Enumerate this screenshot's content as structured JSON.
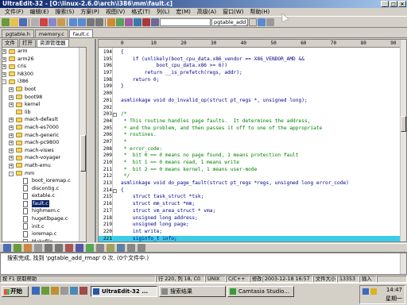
{
  "window": {
    "title": "UltraEdit-32 - [O:\\linux-2.6.0\\arch\\i386\\mm\\fault.c]",
    "buttons": [
      "_",
      "□",
      "×"
    ]
  },
  "menu": [
    "文件(F)",
    "编辑(E)",
    "搜索(S)",
    "方案(P)",
    "视图(V)",
    "格式(T)",
    "列(L)",
    "宏(M)",
    "高级(A)",
    "窗口(W)",
    "帮助(H)"
  ],
  "toolbar": {
    "function_combo": "pgtable_add_l",
    "search_combo": ""
  },
  "file_tabs": [
    "pgtable.h",
    "memory.c",
    "fault.c"
  ],
  "left_panel": {
    "tabs": [
      "文件",
      "打开",
      "资源管理器"
    ],
    "tree": [
      {
        "label": "arm",
        "type": "folder",
        "indent": 1,
        "toggle": "+"
      },
      {
        "label": "arm26",
        "type": "folder",
        "indent": 1,
        "toggle": "+"
      },
      {
        "label": "cris",
        "type": "folder",
        "indent": 1,
        "toggle": "+"
      },
      {
        "label": "h8300",
        "type": "folder",
        "indent": 1,
        "toggle": "+"
      },
      {
        "label": "i386",
        "type": "folder",
        "indent": 1,
        "toggle": "-"
      },
      {
        "label": "boot",
        "type": "folder",
        "indent": 2,
        "toggle": "+"
      },
      {
        "label": "boot98",
        "type": "folder",
        "indent": 2,
        "toggle": "+"
      },
      {
        "label": "kernel",
        "type": "folder",
        "indent": 2,
        "toggle": "+"
      },
      {
        "label": "lib",
        "type": "folder",
        "indent": 2,
        "toggle": ""
      },
      {
        "label": "mach-default",
        "type": "folder",
        "indent": 2,
        "toggle": "+"
      },
      {
        "label": "mach-es7000",
        "type": "folder",
        "indent": 2,
        "toggle": "+"
      },
      {
        "label": "mach-generic",
        "type": "folder",
        "indent": 2,
        "toggle": "+"
      },
      {
        "label": "mach-pc9800",
        "type": "folder",
        "indent": 2,
        "toggle": "+"
      },
      {
        "label": "mach-visws",
        "type": "folder",
        "indent": 2,
        "toggle": "+"
      },
      {
        "label": "mach-voyager",
        "type": "folder",
        "indent": 2,
        "toggle": "+"
      },
      {
        "label": "math-emu",
        "type": "folder",
        "indent": 2,
        "toggle": "+"
      },
      {
        "label": "mm",
        "type": "folder",
        "indent": 2,
        "toggle": "-"
      },
      {
        "label": "boot_ioremap.c",
        "type": "file",
        "indent": 3,
        "toggle": ""
      },
      {
        "label": "discontig.c",
        "type": "file",
        "indent": 3,
        "toggle": ""
      },
      {
        "label": "extable.c",
        "type": "file",
        "indent": 3,
        "toggle": ""
      },
      {
        "label": "fault.c",
        "type": "file",
        "indent": 3,
        "toggle": "",
        "selected": true
      },
      {
        "label": "highmem.c",
        "type": "file",
        "indent": 3,
        "toggle": ""
      },
      {
        "label": "hugetlbpage.c",
        "type": "file",
        "indent": 3,
        "toggle": ""
      },
      {
        "label": "init.c",
        "type": "file",
        "indent": 3,
        "toggle": ""
      },
      {
        "label": "ioremap.c",
        "type": "file",
        "indent": 3,
        "toggle": ""
      },
      {
        "label": "Makefile",
        "type": "file",
        "indent": 3,
        "toggle": ""
      },
      {
        "label": "pageattr.c",
        "type": "file",
        "indent": 3,
        "toggle": ""
      },
      {
        "label": "pgtable.c",
        "type": "file",
        "indent": 3,
        "toggle": ""
      }
    ]
  },
  "ruler_marks": [
    "0",
    "10",
    "20",
    "30",
    "40",
    "50",
    "60",
    "70",
    "80",
    "90"
  ],
  "code_lines": [
    {
      "num": "194",
      "text": "{",
      "fold": "",
      "cls": ""
    },
    {
      "num": "195",
      "text": "    if (unlikely(boot_cpu_data.x86_vendor == X86_VENDOR_AMD &&",
      "fold": "",
      "cls": ""
    },
    {
      "num": "196",
      "text": "            boot_cpu_data.x86 >= 6))",
      "fold": "",
      "cls": ""
    },
    {
      "num": "197",
      "text": "        return __is_prefetch(regs, addr);",
      "fold": "",
      "cls": ""
    },
    {
      "num": "198",
      "text": "    return 0;",
      "fold": "",
      "cls": ""
    },
    {
      "num": "199",
      "text": "}",
      "fold": "",
      "cls": ""
    },
    {
      "num": "200",
      "text": "",
      "fold": "",
      "cls": ""
    },
    {
      "num": "201",
      "text": "asmlinkage void do_invalid_op(struct pt_regs *, unsigned long);",
      "fold": "",
      "cls": ""
    },
    {
      "num": "202",
      "text": "",
      "fold": "",
      "cls": ""
    },
    {
      "num": "203",
      "text": "/*",
      "fold": "-",
      "cls": "cmt"
    },
    {
      "num": "204",
      "text": " * This routine handles page faults.  It determines the address,",
      "fold": "",
      "cls": "cmt"
    },
    {
      "num": "205",
      "text": " * and the problem, and then passes it off to one of the appropriate",
      "fold": "",
      "cls": "cmt"
    },
    {
      "num": "206",
      "text": " * routines.",
      "fold": "",
      "cls": "cmt"
    },
    {
      "num": "207",
      "text": " *",
      "fold": "",
      "cls": "cmt"
    },
    {
      "num": "208",
      "text": " * error_code:",
      "fold": "",
      "cls": "cmt"
    },
    {
      "num": "209",
      "text": " *  bit 0 == 0 means no page found, 1 means protection fault",
      "fold": "",
      "cls": "cmt"
    },
    {
      "num": "210",
      "text": " *  bit 1 == 0 means read, 1 means write",
      "fold": "",
      "cls": "cmt"
    },
    {
      "num": "211",
      "text": " *  bit 2 == 0 means kernel, 1 means user-mode",
      "fold": "",
      "cls": "cmt"
    },
    {
      "num": "212",
      "text": " */",
      "fold": "",
      "cls": "cmt"
    },
    {
      "num": "213",
      "text": "asmlinkage void do_page_fault(struct pt_regs *regs, unsigned long error_code)",
      "fold": "",
      "cls": ""
    },
    {
      "num": "214",
      "text": "{",
      "fold": "-",
      "cls": ""
    },
    {
      "num": "215",
      "text": "    struct task_struct *tsk;",
      "fold": "",
      "cls": ""
    },
    {
      "num": "216",
      "text": "    struct mm_struct *mm;",
      "fold": "",
      "cls": ""
    },
    {
      "num": "217",
      "text": "    struct vm_area_struct * vma;",
      "fold": "",
      "cls": ""
    },
    {
      "num": "218",
      "text": "    unsigned long address;",
      "fold": "",
      "cls": ""
    },
    {
      "num": "219",
      "text": "    unsigned long page;",
      "fold": "",
      "cls": ""
    },
    {
      "num": "220",
      "text": "    int write;",
      "fold": "",
      "cls": ""
    },
    {
      "num": "221",
      "text": "    siginfo_t info;",
      "fold": "",
      "cls": "",
      "highlight": true
    }
  ],
  "output": {
    "text": "搜索完成, 找到 'pgtable_add_rmap' 0 次.  (0个文件中.)"
  },
  "status": {
    "help": "按 F1 获取帮助",
    "position": "行 220, 列 18, C0",
    "line_ending": "UNIX",
    "syntax": "C/C++",
    "modified": "修改:",
    "date": "2003-12-18 16:57",
    "size_label": "文件大小:",
    "size": "13353",
    "mode": "插入"
  },
  "taskbar": {
    "start": "开始",
    "tasks": [
      {
        "label": "UltraEdit-32 ...",
        "active": true
      },
      {
        "label": "搜索结果",
        "active": false
      },
      {
        "label": "Camtasia Studio...",
        "active": false
      }
    ],
    "clock_time": "14:47",
    "clock_day": "星期一"
  },
  "colors": {
    "title_start": "#0a246a",
    "title_end": "#a6caf0",
    "highlight_line": "#3ccde6",
    "comment": "#008000",
    "code": "#00008b"
  }
}
